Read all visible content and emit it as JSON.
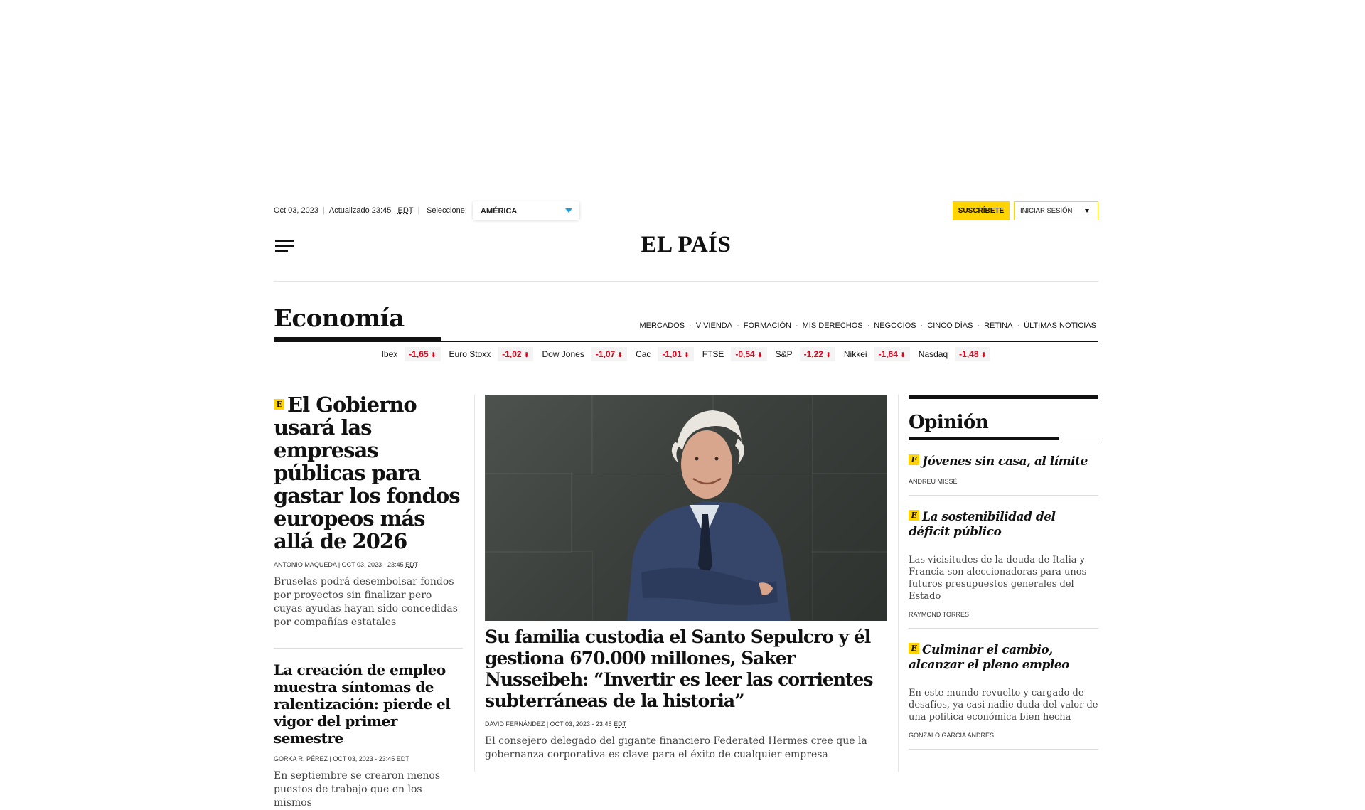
{
  "topbar": {
    "date": "Oct 03, 2023",
    "updated": "Actualizado 23:45",
    "tz": "EDT",
    "select_label": "Seleccione:",
    "edition": "AMÉRICA",
    "subscribe": "SUSCRÍBETE",
    "login": "INICIAR SESIÓN"
  },
  "logo": "EL PAÍS",
  "section": {
    "title": "Economía",
    "nav": [
      "MERCADOS",
      "VIVIENDA",
      "FORMACIÓN",
      "MIS DERECHOS",
      "NEGOCIOS",
      "CINCO DÍAS",
      "RETINA",
      "ÚLTIMAS NOTICIAS"
    ]
  },
  "markets": [
    {
      "name": "Ibex",
      "value": "-1,65"
    },
    {
      "name": "Euro Stoxx",
      "value": "-1,02"
    },
    {
      "name": "Dow Jones",
      "value": "-1,07"
    },
    {
      "name": "Cac",
      "value": "-1,01"
    },
    {
      "name": "FTSE",
      "value": "-0,54"
    },
    {
      "name": "S&P",
      "value": "-1,22"
    },
    {
      "name": "Nikkei",
      "value": "-1,64"
    },
    {
      "name": "Nasdaq",
      "value": "-1,48"
    }
  ],
  "badge_letter": "E",
  "down_arrow": "⬇",
  "left": {
    "lead": {
      "headline": "El Gobierno usará las empresas públicas para gastar los fondos europeos más allá de 2026",
      "byline": "ANTONIO MAQUEDA | OCT 03, 2023 - 23:45",
      "tz": "EDT",
      "summary": "Bruselas podrá desembolsar fondos por proyectos sin finalizar pero cuyas ayudas hayan sido concedidas por compañías estatales"
    },
    "second": {
      "headline": "La creación de empleo muestra síntomas de ralentización: pierde el vigor del primer semestre",
      "byline": "GORKA R. PÉREZ | OCT 03, 2023 - 23:45",
      "tz": "EDT",
      "summary": "En septiembre se crearon menos puestos de trabajo que en los mismos"
    }
  },
  "center": {
    "headline": "Su familia custodia el Santo Sepulcro y él gestiona 670.000 millones, Saker Nusseibeh: “Invertir es leer las corrientes subterráneas de la historia”",
    "byline": "DAVID FERNÁNDEZ | OCT 03, 2023 - 23:45",
    "tz": "EDT",
    "summary": "El consejero delegado del gigante financiero Federated Hermes cree que la gobernanza corporativa es clave para el éxito de cualquier empresa"
  },
  "opinion": {
    "title": "Opinión",
    "items": [
      {
        "headline": "Jóvenes sin casa, al límite",
        "author": "ANDREU MISSÉ"
      },
      {
        "headline": "La sostenibilidad del déficit público",
        "summary": "Las vicisitudes de la deuda de Italia y Francia son aleccionadoras para unos futuros presupuestos generales del Estado",
        "author": "RAYMOND TORRES"
      },
      {
        "headline": "Culminar el cambio, alcanzar el pleno empleo",
        "summary": "En este mundo revuelto y cargado de desafíos, ya casi nadie duda del valor de una política económica bien hecha",
        "author": "GONZALO GARCÍA ANDRÉS"
      }
    ]
  },
  "colors": {
    "accent_yellow": "#ffd400",
    "market_red": "#e2001a",
    "dropdown_blue": "#1a9ee0"
  }
}
